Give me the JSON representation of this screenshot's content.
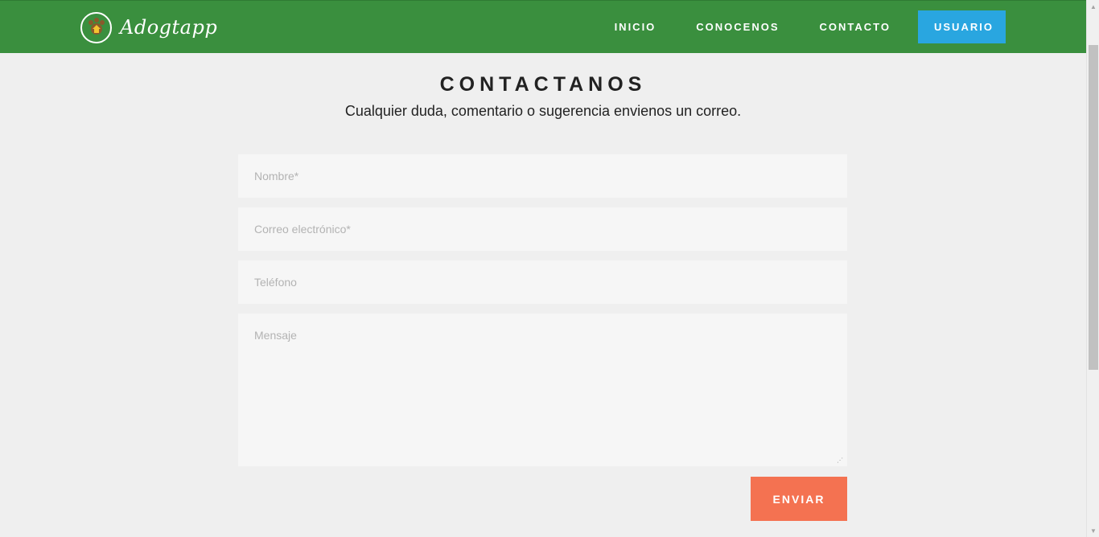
{
  "navbar": {
    "brand_name": "Adogtapp",
    "brand_logo_icon": "paw-house-icon",
    "links": [
      {
        "label": "INICIO"
      },
      {
        "label": "CONOCENOS"
      },
      {
        "label": "CONTACTO"
      }
    ],
    "user_button_label": "USUARIO"
  },
  "contact": {
    "title": "CONTACTANOS",
    "subtitle": "Cualquier duda, comentario o sugerencia envienos un correo.",
    "fields": {
      "name_placeholder": "Nombre*",
      "email_placeholder": "Correo electrónico*",
      "phone_placeholder": "Teléfono",
      "message_placeholder": "Mensaje"
    },
    "submit_label": "ENVIAR"
  },
  "colors": {
    "navbar_bg": "#3a8f3e",
    "user_button_bg": "#29a6e0",
    "submit_bg": "#f47251",
    "page_bg": "#efefef"
  }
}
